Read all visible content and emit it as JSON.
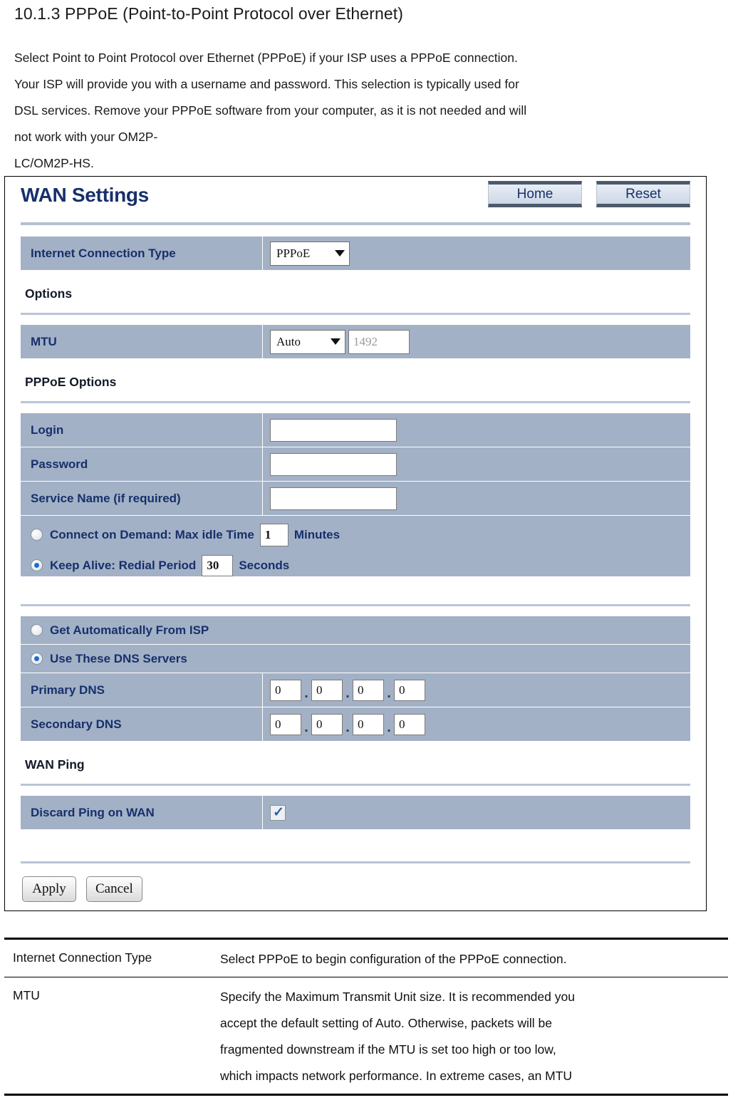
{
  "document": {
    "heading": "10.1.3 PPPoE (Point-to-Point Protocol over Ethernet)",
    "paragraph_lines": [
      "Select Point to Point Protocol over Ethernet (PPPoE) if      your ISP uses a PPPoE connection.",
      "Your ISP will provide you with a username and password. This selection is typically used for",
      "DSL services. Remove  your PPPoE software from  your computer, as it is not needed and will",
      "not work with your OM2P-",
      "LC/OM2P-HS."
    ]
  },
  "panel": {
    "title": "WAN Settings",
    "buttons": {
      "home": "Home",
      "reset": "Reset"
    },
    "internet_connection_type": {
      "label": "Internet Connection Type",
      "value": "PPPoE"
    },
    "options": {
      "section_title": "Options",
      "mtu": {
        "label": "MTU",
        "mode": "Auto",
        "value": "1492"
      }
    },
    "pppoe_options": {
      "section_title": "PPPoE Options",
      "login": {
        "label": "Login",
        "value": ""
      },
      "password": {
        "label": "Password",
        "value": ""
      },
      "service_name": {
        "label": "Service Name (if required)",
        "value": ""
      },
      "connect_on_demand": {
        "label": "Connect on Demand: Max idle Time",
        "value": "1",
        "unit": "Minutes",
        "selected": false
      },
      "keep_alive": {
        "label": "Keep Alive: Redial Period",
        "value": "30",
        "unit": "Seconds",
        "selected": true
      }
    },
    "dns": {
      "get_automatically": {
        "label": "Get Automatically From ISP",
        "selected": false
      },
      "use_these": {
        "label": "Use These DNS Servers",
        "selected": true
      },
      "primary": {
        "label": "Primary DNS",
        "octets": [
          "0",
          "0",
          "0",
          "0"
        ]
      },
      "secondary": {
        "label": "Secondary DNS",
        "octets": [
          "0",
          "0",
          "0",
          "0"
        ]
      },
      "separator": "."
    },
    "wan_ping": {
      "section_title": "WAN Ping",
      "discard": {
        "label": "Discard Ping on WAN",
        "checked": true,
        "tick_glyph": "✓"
      }
    },
    "actions": {
      "apply": "Apply",
      "cancel": "Cancel"
    }
  },
  "description_table": {
    "rows": [
      {
        "term_lines": [
          "Internet Connection",
          "Type"
        ],
        "def_lines": [
          "Select PPPoE to begin configuration  of the PPPoE connection."
        ]
      },
      {
        "term_lines": [
          "MTU"
        ],
        "def_lines": [
          "Specify the Maximum Transmit Unit size. It is recommended you",
          "accept the default setting of Auto. Otherwise, packets will be",
          "fragmented downstream if the MTU is set too  high or too  low,",
          "which impacts network performance. In extreme cases, an MTU"
        ]
      }
    ]
  },
  "colors": {
    "row_bg": "#a3b1c6",
    "label_text": "#16306b",
    "title_text": "#17306b",
    "rule": "#b9c4d6",
    "radio_dot": "#1a6fd4",
    "check": "#2a5fa8"
  }
}
